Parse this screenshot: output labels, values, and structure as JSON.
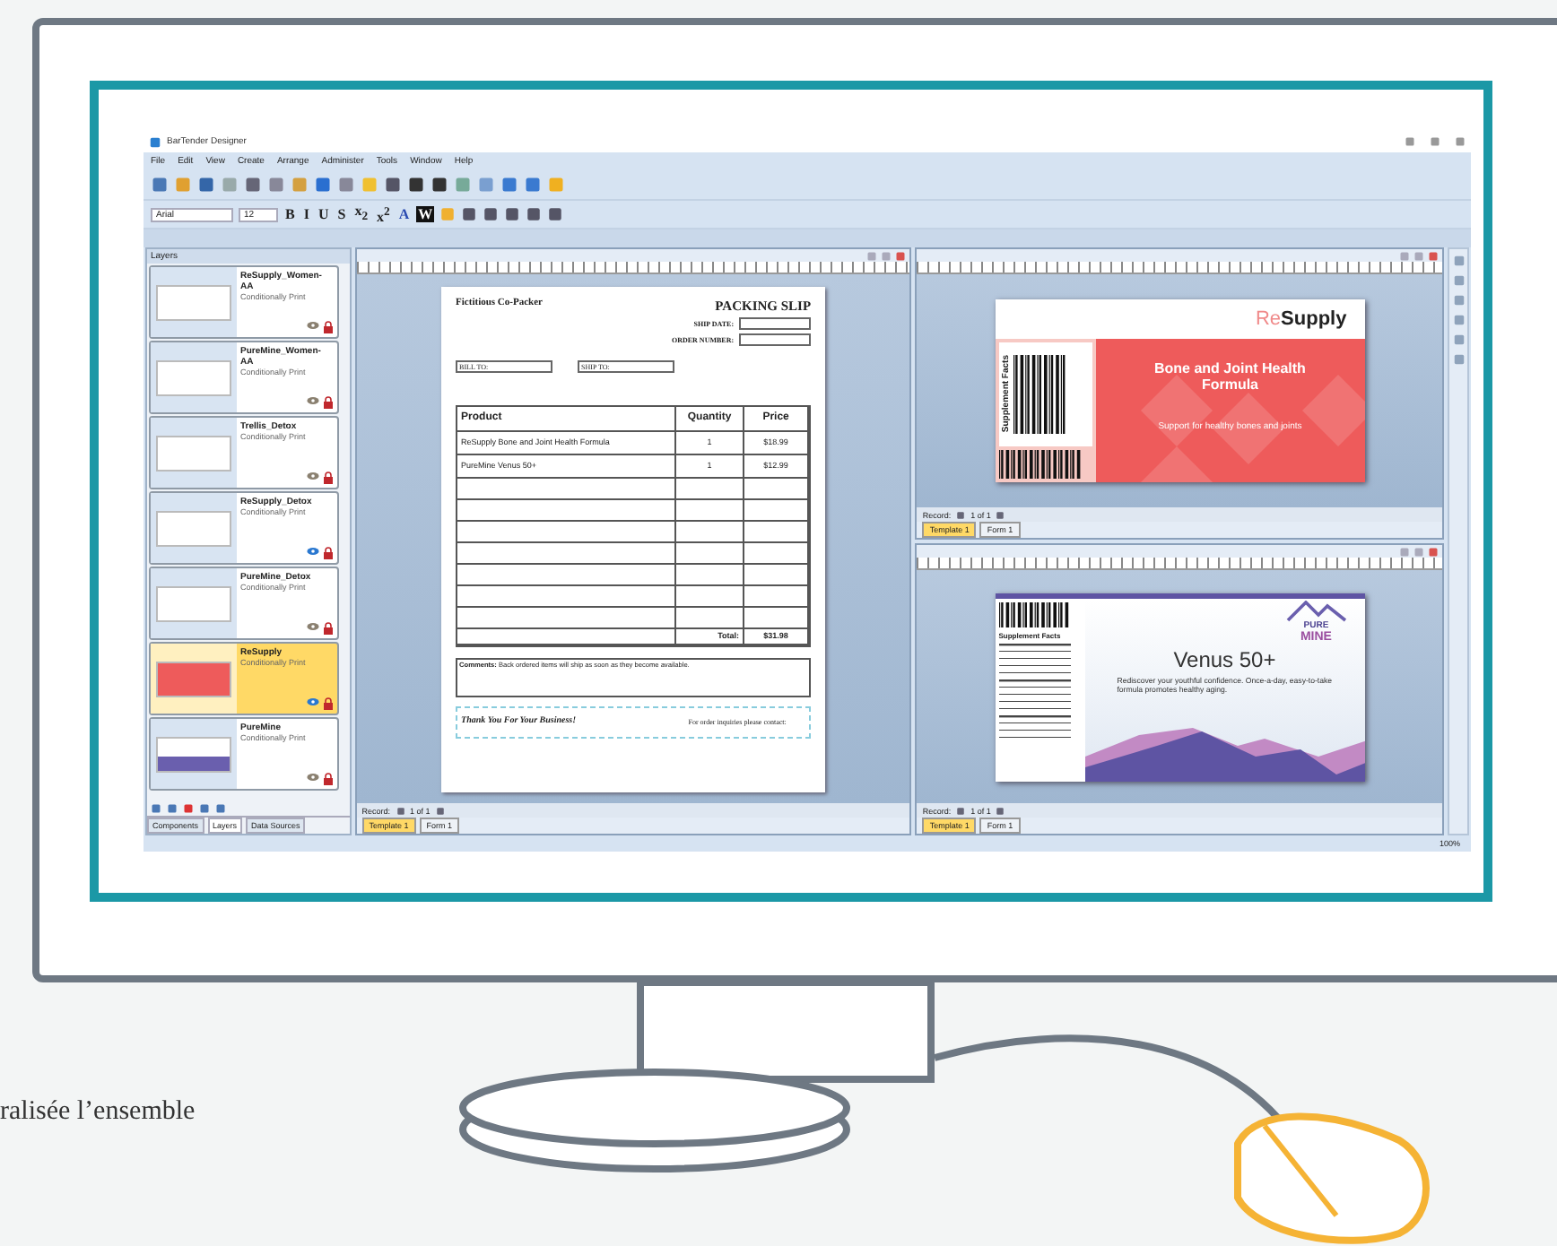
{
  "window": {
    "title": "BarTender Designer"
  },
  "menu": [
    "File",
    "Edit",
    "View",
    "Create",
    "Arrange",
    "Administer",
    "Tools",
    "Window",
    "Help"
  ],
  "font_bar": {
    "font": "Arial",
    "size": "12",
    "format_buttons": [
      "B",
      "I",
      "U",
      "S",
      "x$_{2}$",
      "x$^{2}$"
    ],
    "text_color_button": "A",
    "black_button": "W"
  },
  "layers_panel": {
    "title": "Layers",
    "layers": [
      {
        "name": "ReSupply_Women-AA",
        "note": "Conditionally Print",
        "kind": "form",
        "selected": false,
        "visible": false
      },
      {
        "name": "PureMine_Women-AA",
        "note": "Conditionally Print",
        "kind": "form",
        "selected": false,
        "visible": false
      },
      {
        "name": "Trellis_Detox",
        "note": "Conditionally Print",
        "kind": "form",
        "selected": false,
        "visible": false
      },
      {
        "name": "ReSupply_Detox",
        "note": "Conditionally Print",
        "kind": "form",
        "selected": false,
        "visible": true
      },
      {
        "name": "PureMine_Detox",
        "note": "Conditionally Print",
        "kind": "form",
        "selected": false,
        "visible": false
      },
      {
        "name": "ReSupply",
        "note": "Conditionally Print",
        "kind": "resupply",
        "selected": true,
        "visible": true
      },
      {
        "name": "PureMine",
        "note": "Conditionally Print",
        "kind": "puremine",
        "selected": false,
        "visible": false
      }
    ],
    "tabs": [
      {
        "label": "Components",
        "selected": false
      },
      {
        "label": "Layers",
        "selected": true
      },
      {
        "label": "Data Sources",
        "selected": false
      }
    ]
  },
  "packing_slip": {
    "company": "Fictitious Co-Packer",
    "title": "PACKING SLIP",
    "ship_date_label": "SHIP DATE:",
    "order_number_label": "ORDER NUMBER:",
    "bill_to": "BILL TO:",
    "ship_to": "SHIP TO:",
    "columns": [
      "Product",
      "Quantity",
      "Price"
    ],
    "rows": [
      {
        "product": "ReSupply Bone and Joint Health Formula",
        "quantity": "1",
        "price": "$18.99"
      },
      {
        "product": "PureMine Venus 50+",
        "quantity": "1",
        "price": "$12.99"
      }
    ],
    "total_label": "Total:",
    "total": "$31.98",
    "comments": "**Comments:** Back ordered items will ship as soon as they become available.",
    "thanks": "Thank You For Your Business!",
    "contact": "For order inquiries please contact:"
  },
  "resupply_label": {
    "logo_prefix": "Re",
    "logo_main": "Supply",
    "side_title": "Supplement Facts",
    "title": "Bone and Joint Health Formula",
    "subtitle": "Support for healthy bones and joints"
  },
  "puremine_label": {
    "facts_title": "Supplement Facts",
    "logo_top": "PURE",
    "logo_bottom": "MINE",
    "title": "Venus 50+",
    "description": "Rediscover your youthful confidence. Once-a-day, easy-to-take formula promotes healthy aging."
  },
  "windows": [
    {
      "record_label": "Record:",
      "record": "1 of 1",
      "tabs": [
        {
          "label": "Template 1",
          "selected": true
        },
        {
          "label": "Form 1",
          "selected": false
        }
      ]
    },
    {
      "record_label": "Record:",
      "record": "1 of 1",
      "tabs": [
        {
          "label": "Template 1",
          "selected": true
        },
        {
          "label": "Form 1",
          "selected": false
        }
      ]
    },
    {
      "record_label": "Record:",
      "record": "1 of 1",
      "tabs": [
        {
          "label": "Template 1",
          "selected": true
        },
        {
          "label": "Form 1",
          "selected": false
        }
      ]
    }
  ],
  "status_bar": {
    "zoom": "100%"
  },
  "page_text": "ralisée l’ensemble"
}
